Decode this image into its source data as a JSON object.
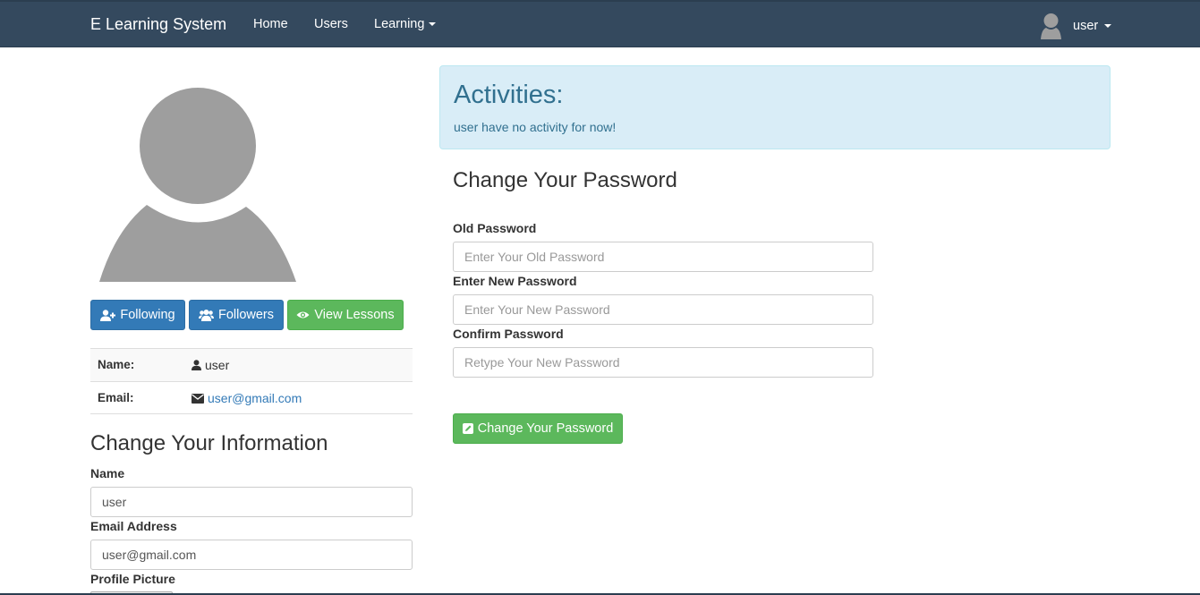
{
  "navbar": {
    "brand": "E Learning System",
    "links": [
      {
        "label": "Home"
      },
      {
        "label": "Users"
      },
      {
        "label": "Learning"
      }
    ],
    "user_label": "user"
  },
  "profile": {
    "buttons": {
      "following": "Following",
      "followers": "Followers",
      "view_lessons": "View Lessons"
    },
    "info": {
      "name_label": "Name:",
      "name_value": "user",
      "email_label": "Email:",
      "email_value": "user@gmail.com"
    }
  },
  "change_info": {
    "title": "Change Your Information",
    "name_label": "Name",
    "name_value": "user",
    "email_label": "Email Address",
    "email_value": "user@gmail.com",
    "picture_label": "Profile Picture"
  },
  "activities": {
    "title": "Activities:",
    "message": "user have no activity for now!"
  },
  "change_password": {
    "title": "Change Your Password",
    "old_label": "Old Password",
    "old_placeholder": "Enter Your Old Password",
    "new_label": "Enter New Password",
    "new_placeholder": "Enter Your New Password",
    "confirm_label": "Confirm Password",
    "confirm_placeholder": "Retype Your New Password",
    "submit_label": "Change Your Password"
  },
  "colors": {
    "navbar": "#34495e",
    "primary": "#337ab7",
    "success": "#5cb85c",
    "info_bg": "#d9edf7",
    "info_text": "#31708f",
    "avatar_gray": "#9e9e9e"
  }
}
